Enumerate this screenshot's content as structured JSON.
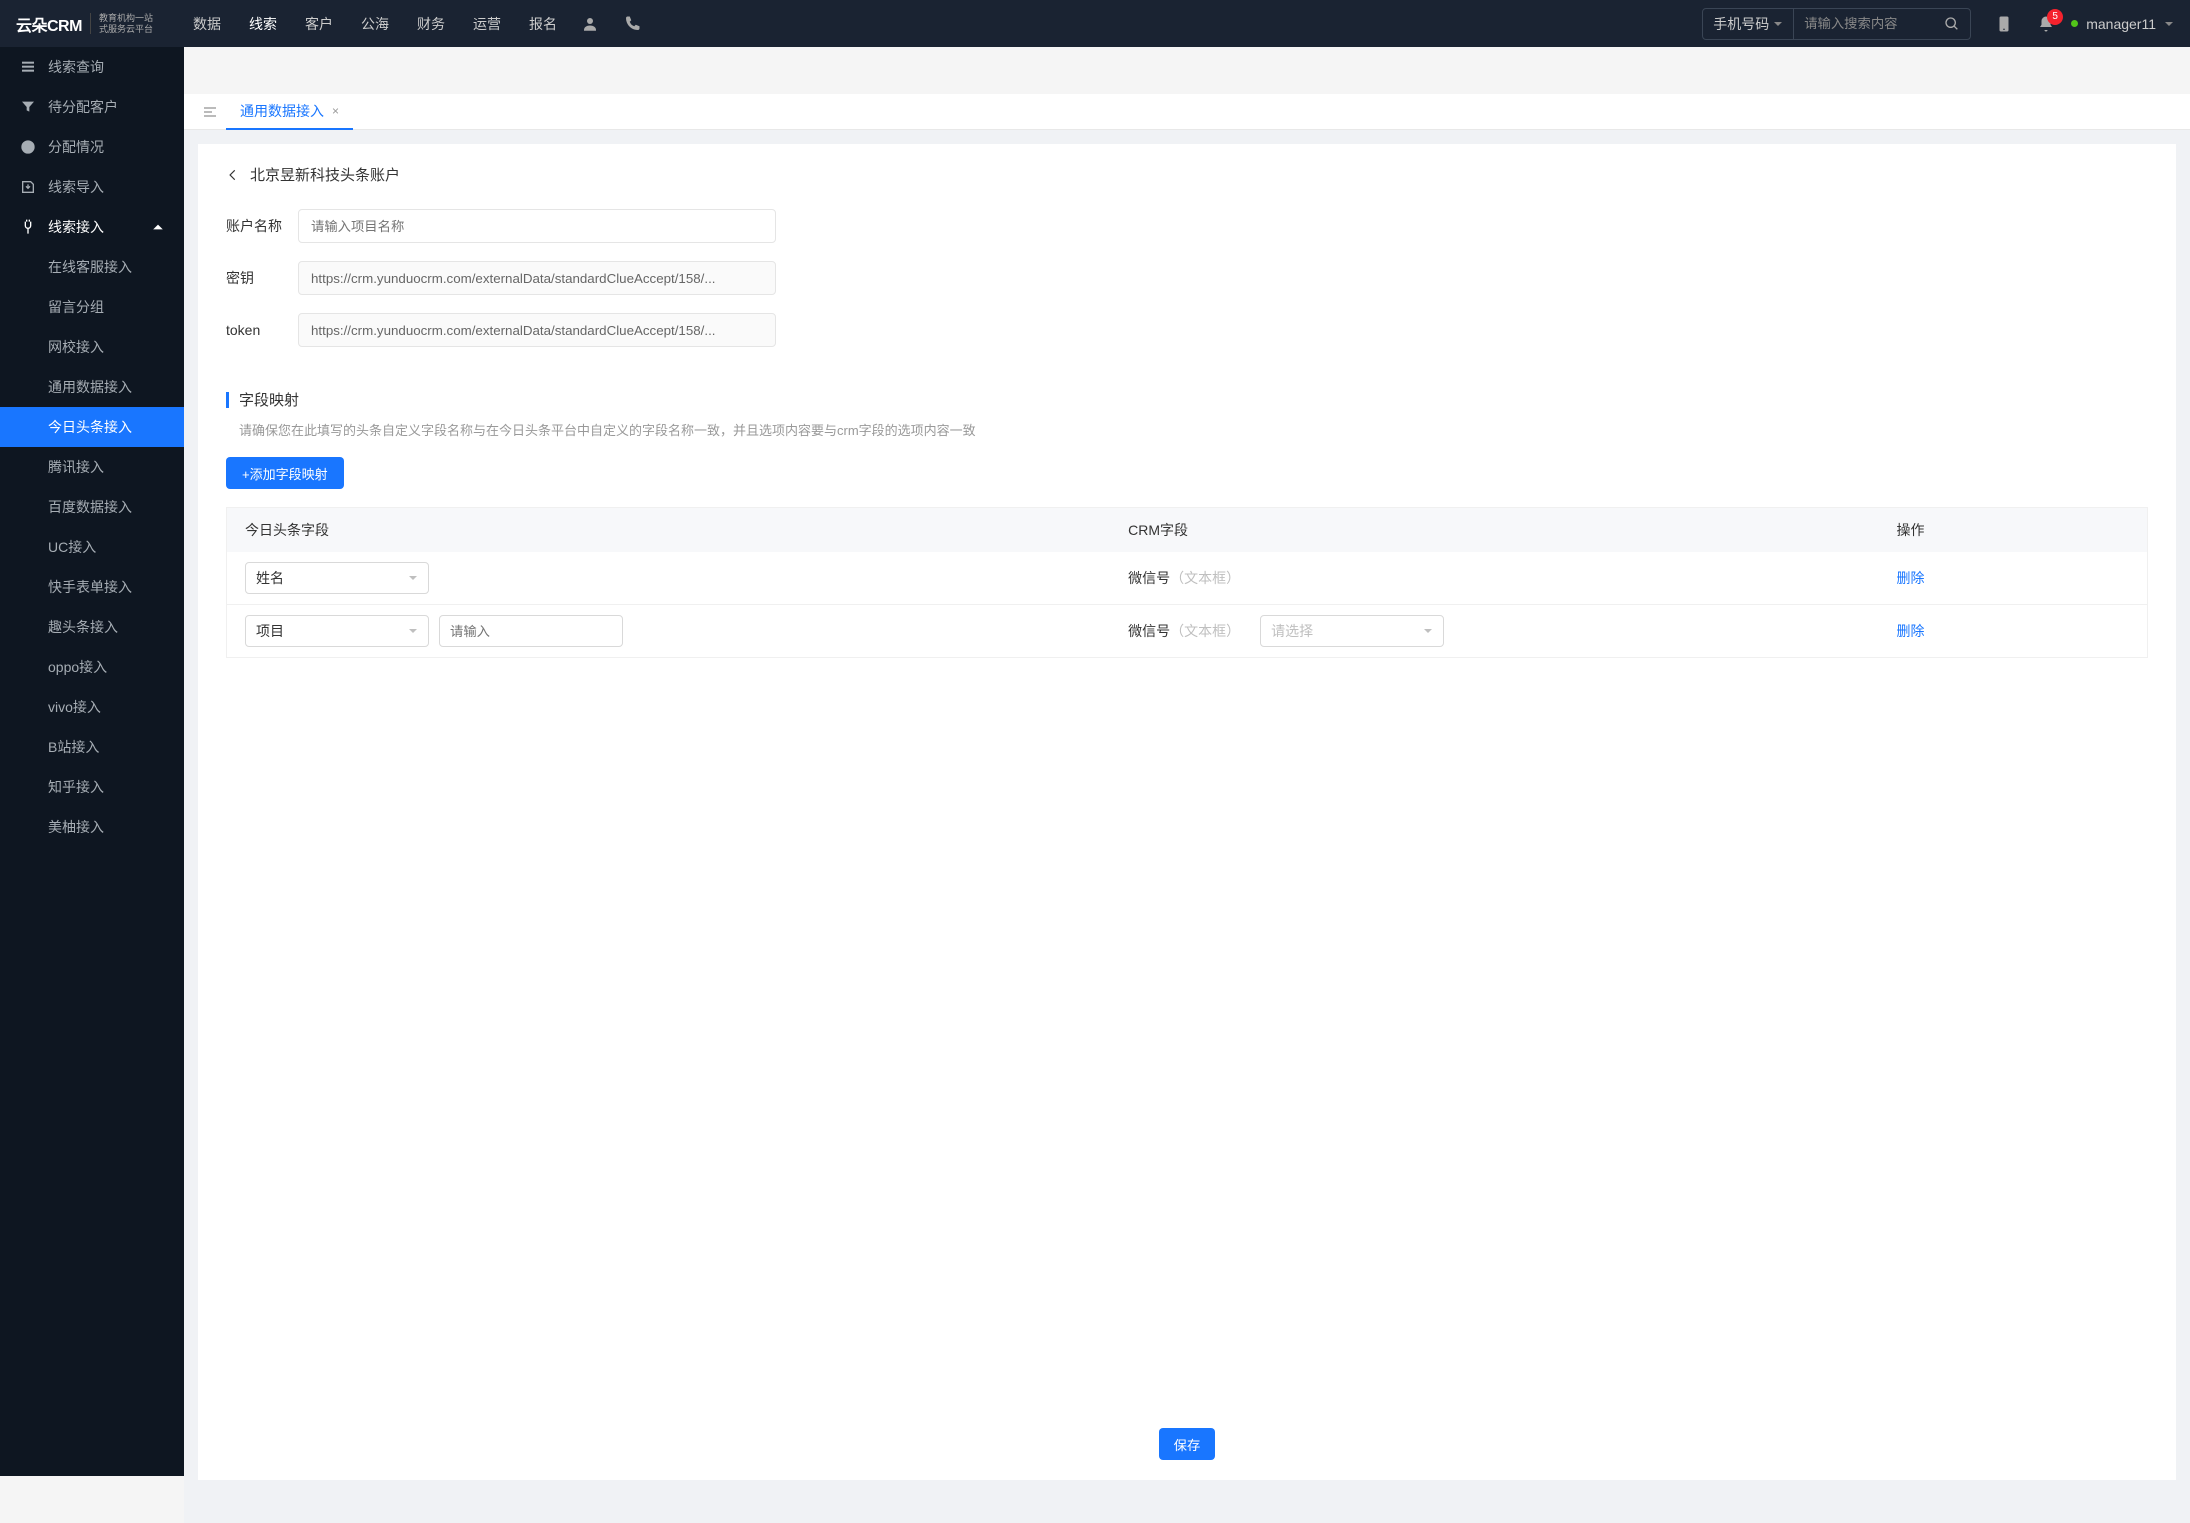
{
  "header": {
    "logo_text": "云朵CRM",
    "logo_sub1": "教育机构一站",
    "logo_sub2": "式服务云平台",
    "nav": [
      "数据",
      "线索",
      "客户",
      "公海",
      "财务",
      "运营",
      "报名"
    ],
    "nav_active_index": 1,
    "search_type": "手机号码",
    "search_placeholder": "请输入搜索内容",
    "badge_count": "5",
    "username": "manager11"
  },
  "sidebar": {
    "items": [
      {
        "label": "线索查询"
      },
      {
        "label": "待分配客户"
      },
      {
        "label": "分配情况"
      },
      {
        "label": "线索导入"
      },
      {
        "label": "线索接入",
        "expanded": true
      }
    ],
    "subitems": [
      "在线客服接入",
      "留言分组",
      "网校接入",
      "通用数据接入",
      "今日头条接入",
      "腾讯接入",
      "百度数据接入",
      "UC接入",
      "快手表单接入",
      "趣头条接入",
      "oppo接入",
      "vivo接入",
      "B站接入",
      "知乎接入",
      "美柚接入"
    ],
    "active_sub_index": 4
  },
  "tabs": {
    "items": [
      {
        "label": "通用数据接入"
      }
    ],
    "active_index": 0
  },
  "page": {
    "title": "北京昱新科技头条账户",
    "form": {
      "account_label": "账户名称",
      "account_placeholder": "请输入项目名称",
      "secret_label": "密钥",
      "secret_value": "https://crm.yunduocrm.com/externalData/standardClueAccept/158/...",
      "token_label": "token",
      "token_value": "https://crm.yunduocrm.com/externalData/standardClueAccept/158/..."
    },
    "section": {
      "title": "字段映射",
      "desc": "请确保您在此填写的头条自定义字段名称与在今日头条平台中自定义的字段名称一致，并且选项内容要与crm字段的选项内容一致",
      "add_button": "+添加字段映射"
    },
    "table": {
      "columns": [
        "今日头条字段",
        "CRM字段",
        "操作"
      ],
      "rows": [
        {
          "toutiao_field": "姓名",
          "extra_input": false,
          "crm_name": "微信号",
          "crm_type": "（文本框）",
          "crm_select": false,
          "action": "删除"
        },
        {
          "toutiao_field": "项目",
          "extra_input": true,
          "extra_placeholder": "请输入",
          "crm_name": "微信号",
          "crm_type": "（文本框）",
          "crm_select": true,
          "crm_select_placeholder": "请选择",
          "action": "删除"
        }
      ]
    },
    "save_button": "保存"
  }
}
